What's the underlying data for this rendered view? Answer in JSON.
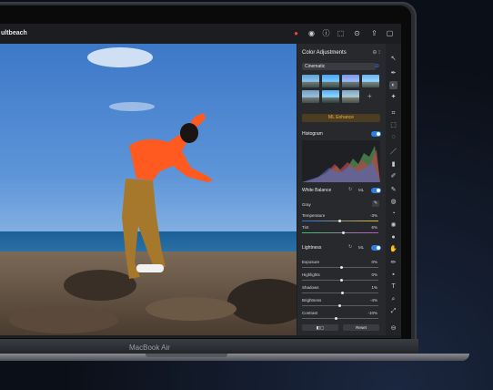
{
  "device": {
    "model_label": "MacBook Air"
  },
  "window": {
    "document_title": "ultbeach"
  },
  "toolbar_icons": [
    "share-icon",
    "profile-icon",
    "info-icon",
    "export-icon",
    "compare-icon",
    "sidebar-icon"
  ],
  "panel": {
    "title": "Color Adjustments",
    "preset": "Cinematic",
    "ml_button": "ML Enhance",
    "histogram": {
      "label": "Histogram"
    },
    "white_balance": {
      "label": "White Balance",
      "badge": "ML",
      "gray_label": "Gray",
      "sliders": [
        {
          "label": "Temperature",
          "value": "-3%"
        },
        {
          "label": "Tint",
          "value": "6%"
        }
      ]
    },
    "lightness": {
      "label": "Lightness",
      "badge": "ML",
      "sliders": [
        {
          "label": "Exposure",
          "value": "0%"
        },
        {
          "label": "Highlights",
          "value": "0%"
        },
        {
          "label": "Shadows",
          "value": "1%"
        },
        {
          "label": "Brightness",
          "value": "-4%"
        },
        {
          "label": "Contrast",
          "value": "-10%"
        }
      ]
    },
    "footer": {
      "reset_label": "Reset"
    }
  },
  "colors": {
    "accent": "#2f7de1",
    "ml_orange": "#f0b545"
  }
}
